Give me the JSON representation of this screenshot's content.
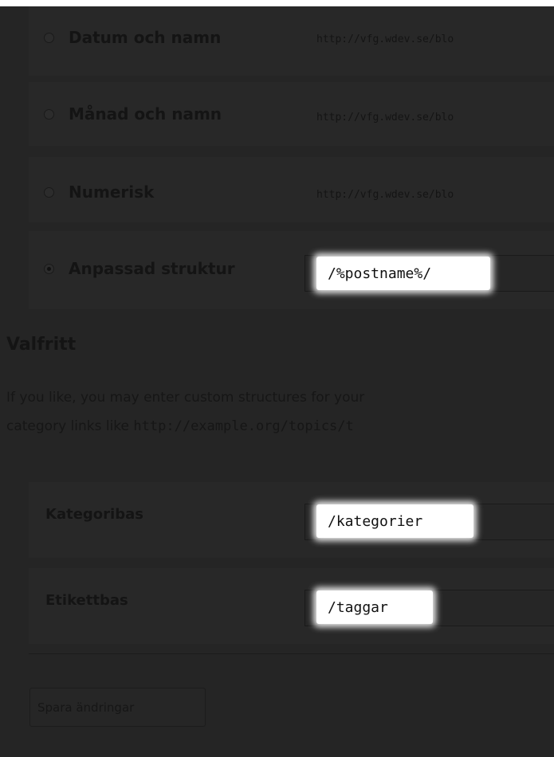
{
  "permalink_options": [
    {
      "label": "Datum och namn",
      "url": "http://vfg.wdev.se/blo",
      "checked": false
    },
    {
      "label": "Månad och namn",
      "url": "http://vfg.wdev.se/blo",
      "checked": false
    },
    {
      "label": "Numerisk",
      "url": "http://vfg.wdev.se/blo",
      "checked": false
    }
  ],
  "custom_structure": {
    "label": "Anpassad struktur",
    "value": "/%postname%/",
    "checked": true
  },
  "optional": {
    "heading": "Valfritt",
    "description_line1": "If you like, you may enter custom structures for your",
    "description_line2_text": "category links like ",
    "description_line2_code": "http://example.org/topics/t"
  },
  "category_base": {
    "label": "Kategoribas",
    "value": "/kategorier"
  },
  "tag_base": {
    "label": "Etikettbas",
    "value": "/taggar"
  },
  "save_button": "Spara ändringar"
}
